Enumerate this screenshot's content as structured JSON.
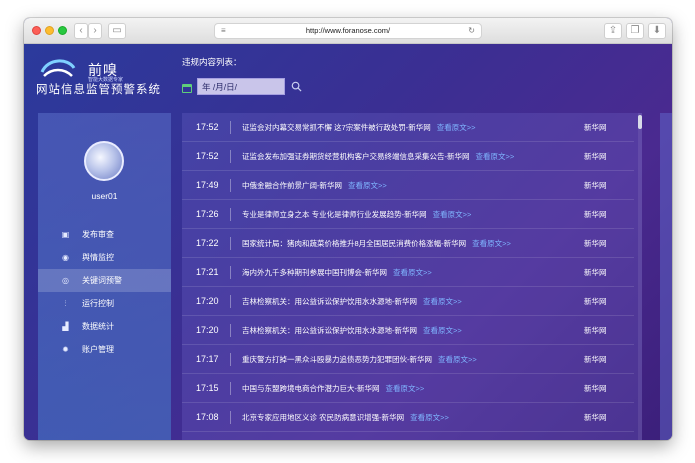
{
  "browser": {
    "url": "http://www.foranose.com/",
    "controls": [
      "back-icon",
      "forward-icon",
      "sidebar-icon",
      "share-icon",
      "tabs-icon",
      "download-icon"
    ]
  },
  "app": {
    "logo_name": "前嗅",
    "logo_sub": "智能大数据专家",
    "title": "网站信息监管预警系统",
    "list_heading": "违规内容列表：",
    "date_placeholder": "年 /月/日/"
  },
  "sidebar": {
    "username": "user01",
    "items": [
      {
        "label": "发布审查",
        "icon": "review-icon"
      },
      {
        "label": "舆情监控",
        "icon": "monitor-icon"
      },
      {
        "label": "关键词预警",
        "icon": "keyword-alert-icon",
        "active": true
      },
      {
        "label": "运行控制",
        "icon": "control-sliders-icon"
      },
      {
        "label": "数据统计",
        "icon": "stats-icon"
      },
      {
        "label": "账户管理",
        "icon": "gear-icon"
      }
    ]
  },
  "list": {
    "more_label": "查看原文>>",
    "rows": [
      {
        "time": "17:52",
        "title": "证监会对内幕交易常抓不懈 这7宗案件被行政处罚-新华网",
        "source": "新华网"
      },
      {
        "time": "17:52",
        "title": "证监会发布加强证券期货经营机构客户交易终端信息采集公告-新华网",
        "source": "新华网"
      },
      {
        "time": "17:49",
        "title": "中俄金融合作前景广阔-新华网",
        "source": "新华网"
      },
      {
        "time": "17:26",
        "title": "专业是律师立身之本 专业化是律师行业发展趋势-新华网",
        "source": "新华网"
      },
      {
        "time": "17:22",
        "title": "国家统计局：猪肉和蔬菜价格推升8月全国居民消费价格涨幅-新华网",
        "source": "新华网"
      },
      {
        "time": "17:21",
        "title": "海内外九千多种期刊参展中国刊博会-新华网",
        "source": "新华网"
      },
      {
        "time": "17:20",
        "title": "吉林检察机关：用公益诉讼保护饮用水水源地-新华网",
        "source": "新华网"
      },
      {
        "time": "17:20",
        "title": "吉林检察机关：用公益诉讼保护饮用水水源地-新华网",
        "source": "新华网"
      },
      {
        "time": "17:17",
        "title": "重庆警方打掉一黑众斗殴暴力追债恶势力犯罪团伙-新华网",
        "source": "新华网"
      },
      {
        "time": "17:15",
        "title": "中国与东盟跨境电商合作潜力巨大-新华网",
        "source": "新华网"
      },
      {
        "time": "17:08",
        "title": "北京专家应用地区义诊 农民防病意识增强-新华网",
        "source": "新华网"
      }
    ]
  }
}
